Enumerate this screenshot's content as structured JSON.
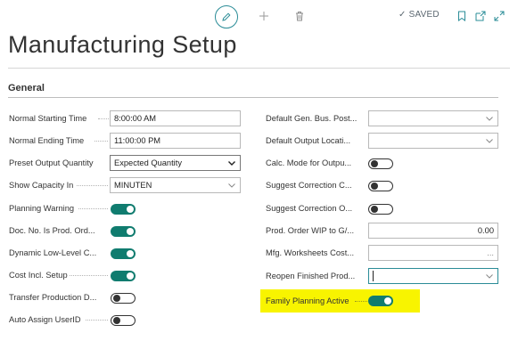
{
  "toolbar": {
    "edit_icon": "pencil-icon",
    "add_icon": "plus-icon",
    "delete_icon": "trash-icon",
    "saved_label": "SAVED",
    "bookmark_icon": "bookmark-icon",
    "open_new_icon": "open-new-window-icon",
    "expand_icon": "expand-icon"
  },
  "page": {
    "title": "Manufacturing Setup"
  },
  "section": {
    "title": "General"
  },
  "left_fields": [
    {
      "label": "Normal Starting Time",
      "type": "text",
      "value": "8:00:00 AM"
    },
    {
      "label": "Normal Ending Time",
      "type": "text",
      "value": "11:00:00 PM"
    },
    {
      "label": "Preset Output Quantity",
      "type": "select",
      "value": "Expected Quantity"
    },
    {
      "label": "Show Capacity In",
      "type": "select",
      "value": "MINUTEN"
    },
    {
      "label": "Planning Warning",
      "type": "toggle",
      "value": "on"
    },
    {
      "label": "Doc. No. Is Prod. Ord...",
      "type": "toggle",
      "value": "on"
    },
    {
      "label": "Dynamic Low-Level C...",
      "type": "toggle",
      "value": "on"
    },
    {
      "label": "Cost Incl. Setup",
      "type": "toggle",
      "value": "on"
    },
    {
      "label": "Transfer Production D...",
      "type": "toggle",
      "value": "off"
    },
    {
      "label": "Auto Assign UserID",
      "type": "toggle",
      "value": "off"
    }
  ],
  "right_fields": [
    {
      "label": "Default Gen. Bus. Post...",
      "type": "select",
      "value": ""
    },
    {
      "label": "Default Output Locati...",
      "type": "select",
      "value": ""
    },
    {
      "label": "Calc. Mode for Outpu...",
      "type": "toggle",
      "value": "off"
    },
    {
      "label": "Suggest Correction C...",
      "type": "toggle",
      "value": "off"
    },
    {
      "label": "Suggest Correction O...",
      "type": "toggle",
      "value": "off"
    },
    {
      "label": "Prod. Order WIP to G/...",
      "type": "number",
      "value": "0.00"
    },
    {
      "label": "Mfg. Worksheets Cost...",
      "type": "lookup",
      "value": "..."
    },
    {
      "label": "Reopen Finished Prod...",
      "type": "select",
      "value": ""
    },
    {
      "label": "Family Planning Active",
      "type": "toggle",
      "value": "on"
    }
  ],
  "colors": {
    "accent": "#107c6f",
    "highlight": "#f8f400",
    "focus": "#2a8c97"
  }
}
